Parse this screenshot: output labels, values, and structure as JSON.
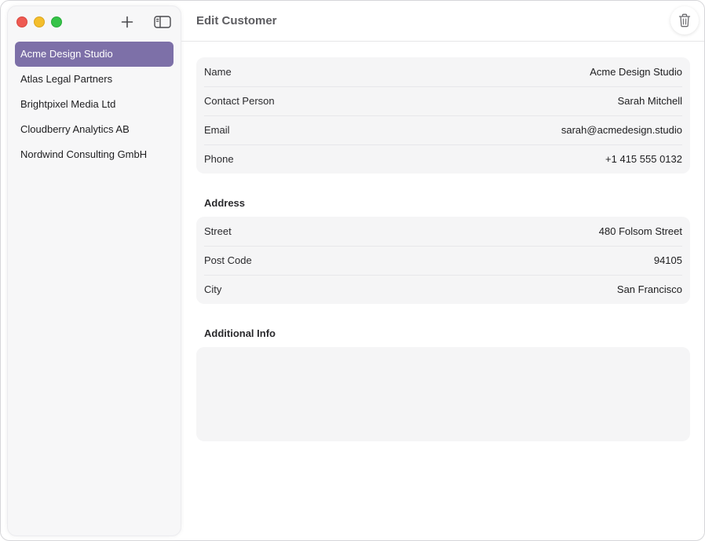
{
  "sidebar": {
    "customers": [
      {
        "name": "Acme Design Studio",
        "selected": true
      },
      {
        "name": "Atlas Legal Partners",
        "selected": false
      },
      {
        "name": "Brightpixel Media Ltd",
        "selected": false
      },
      {
        "name": "Cloudberry Analytics AB",
        "selected": false
      },
      {
        "name": "Nordwind Consulting GmbH",
        "selected": false
      }
    ],
    "icons": {
      "add": "plus-icon",
      "toggle": "sidebar-toggle-icon"
    },
    "selection_color": "#7d70a8"
  },
  "header": {
    "title": "Edit Customer",
    "delete_icon": "trash-icon"
  },
  "contact": {
    "fields": [
      {
        "label": "Name",
        "value": "Acme Design Studio"
      },
      {
        "label": "Contact Person",
        "value": "Sarah Mitchell"
      },
      {
        "label": "Email",
        "value": "sarah@acmedesign.studio"
      },
      {
        "label": "Phone",
        "value": "+1 415 555 0132"
      }
    ]
  },
  "address": {
    "heading": "Address",
    "fields": [
      {
        "label": "Street",
        "value": "480 Folsom Street"
      },
      {
        "label": "Post Code",
        "value": "94105"
      },
      {
        "label": "City",
        "value": "San Francisco"
      }
    ]
  },
  "additional": {
    "heading": "Additional Info",
    "text": ""
  }
}
